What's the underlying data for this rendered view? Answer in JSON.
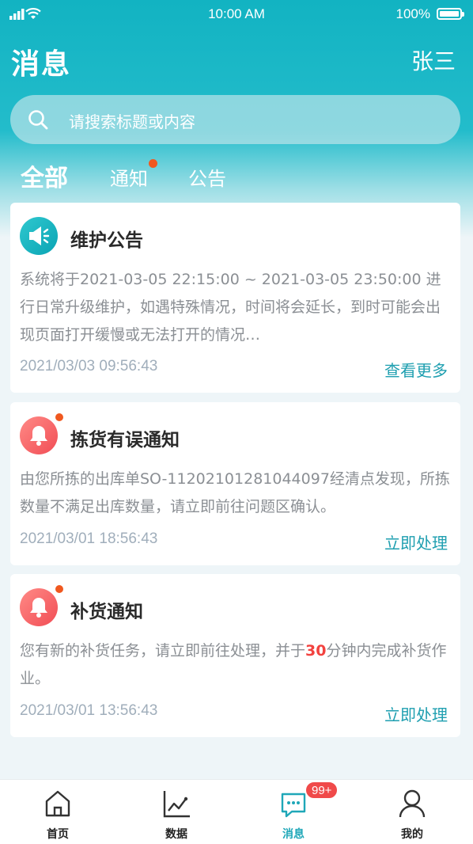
{
  "status_bar": {
    "time": "10:00 AM",
    "battery": "100%"
  },
  "header": {
    "title": "消息",
    "user": "张三"
  },
  "search": {
    "placeholder": "请搜索标题或内容"
  },
  "tabs": [
    {
      "label": "全部"
    },
    {
      "label": "通知"
    },
    {
      "label": "公告"
    }
  ],
  "messages": [
    {
      "title": "维护公告",
      "body": "系统将于2021-03-05 22:15:00 ~ 2021-03-05 23:50:00 进行日常升级维护，如遇特殊情况，时间将会延长，到时可能会出现页面打开缓慢或无法打开的情况…",
      "time": "2021/03/03 09:56:43",
      "action": "查看更多"
    },
    {
      "title": "拣货有误通知",
      "body": "由您所拣的出库单SO-11202101281044097经清点发现，所拣数量不满足出库数量，请立即前往问题区确认。",
      "time": "2021/03/01 18:56:43",
      "action": "立即处理"
    },
    {
      "title": "补货通知",
      "body_pre": "您有新的补货任务，请立即前往处理，并于",
      "body_highlight": "30",
      "body_post": "分钟内完成补货作业。",
      "time": "2021/03/01 13:56:43",
      "action": "立即处理"
    }
  ],
  "bottom_nav": [
    {
      "label": "首页",
      "icon": "home-icon"
    },
    {
      "label": "数据",
      "icon": "chart-icon"
    },
    {
      "label": "消息",
      "icon": "message-icon",
      "badge": "99+"
    },
    {
      "label": "我的",
      "icon": "user-icon"
    }
  ],
  "colors": {
    "primary": "#1fa7b8",
    "highlight": "#f2423f",
    "dot": "#f0581f"
  }
}
